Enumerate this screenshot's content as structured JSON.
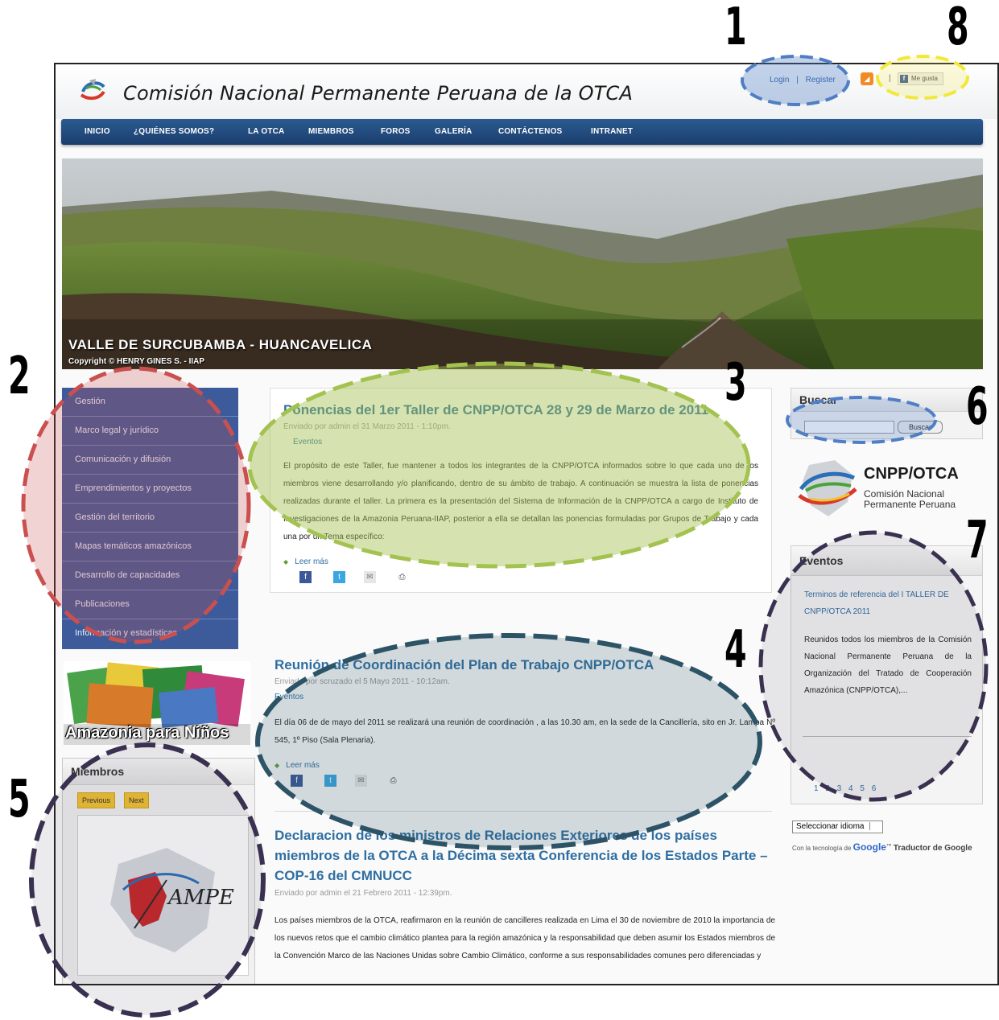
{
  "header": {
    "site_title": "Comisión Nacional Permanente Peruana de la OTCA",
    "login_label": "Login",
    "separator": "|",
    "register_label": "Register",
    "fb_like_label": "Me gusta"
  },
  "nav": {
    "items": [
      "INICIO",
      "¿QUIÉNES SOMOS?",
      "LA OTCA",
      "MIEMBROS",
      "FOROS",
      "GALERÍA",
      "CONTÁCTENOS",
      "INTRANET"
    ]
  },
  "banner": {
    "caption": "VALLE DE SURCUBAMBA - HUANCAVELICA",
    "copyright": "Copyright © HENRY GINES S. - IIAP"
  },
  "left_menu": {
    "items": [
      "Gestión",
      "Marco legal y jurídico",
      "Comunicación y difusión",
      "Emprendimientos y proyectos",
      "Gestión del territorio",
      "Mapas temáticos amazónicos",
      "Desarrollo de capacidades",
      "Publicaciones",
      "Información y estadísticas"
    ]
  },
  "kids_banner": {
    "text": "Amazonia para Niños"
  },
  "miembros": {
    "title": "Miembros",
    "previous_label": "Previous",
    "next_label": "Next",
    "logo_text": "AMPE"
  },
  "articles": [
    {
      "title": "Ponencias del 1er Taller de CNPP/OTCA 28 y 29 de Marzo de 2011",
      "meta": "Enviado por admin el 31 Marzo 2011 - 1:10pm.",
      "tag": "Eventos",
      "body": "El propósito de este Taller, fue mantener a todos los integrantes de la CNPP/OTCA informados sobre lo que cada uno de los miembros viene desarrollando y/o planificando, dentro de su ámbito de trabajo. A continuación se muestra la lista de ponencias realizadas durante el taller. La primera es la presentación del Sistema de Información de la CNPP/OTCA a cargo de Instituto de Investigaciones de la Amazonia Peruana-IIAP, posterior a ella se detallan las ponencias formuladas por Grupos de Trabajo y cada una por un Tema específico:",
      "read_more": "Leer más"
    },
    {
      "title": "Reunión de Coordinación del Plan de Trabajo CNPP/OTCA",
      "meta": "Enviado por scruzado el 5 Mayo 2011 - 10:12am.",
      "tag": "Eventos",
      "body": "El día 06 de de mayo del 2011 se realizará una reunión de coordinación , a las 10.30 am, en la sede de la Cancillería, sito en Jr. Lampa Nº 545, 1º Piso (Sala Plenaria).",
      "read_more": "Leer más"
    },
    {
      "title": "Declaracion de los ministros de Relaciones Exteriores de los países miembros de la OTCA a la Décima sexta Conferencia de los Estados Parte – COP-16 del CMNUCC",
      "meta": "Enviado por admin el 21 Febrero 2011 - 12:39pm.",
      "body": "Los países miembros de la OTCA, reafirmaron en la reunión de cancilleres realizada en Lima el 30 de noviembre de 2010 la importancia de los nuevos retos que el cambio climático plantea para la región amazónica y la responsabilidad que deben asumir los Estados miembros de la Convención Marco de las Naciones Unidas sobre Cambio Climático, conforme a sus responsabilidades comunes pero diferenciadas y"
    }
  ],
  "search": {
    "title": "Buscar",
    "button_label": "Buscar",
    "value": ""
  },
  "cnpp_logo": {
    "name": "CNPP/OTCA",
    "subtitle_line1": "Comisión Nacional",
    "subtitle_line2": "Permanente Peruana"
  },
  "eventos": {
    "title": "Eventos",
    "link": "Terminos de referencia del I TALLER DE CNPP/OTCA 2011",
    "text": "Reunidos todos los miembros de la Comisión Nacional Permanente Peruana de la Organización del Tratado de Cooperación Amazónica (CNPP/OTCA),...",
    "pages": "1 2 3 4 5 6"
  },
  "translate": {
    "select_label": "Seleccionar idioma",
    "powered_prefix": "Con la tecnología de",
    "google": "Google",
    "tm": "™",
    "product": "Traductor de Google"
  },
  "callouts": [
    "1",
    "2",
    "3",
    "4",
    "5",
    "6",
    "7",
    "8"
  ],
  "colors": {
    "nav_blue": "#1f4a7c",
    "menu_blue": "#3d5b9a",
    "link_blue": "#2f6ea2",
    "callout_red": "#c9504f",
    "callout_green": "#a3c24f",
    "callout_blue": "#4f7ec4",
    "callout_yellow": "#f2e83a",
    "callout_dark": "#3a3150",
    "callout_teal": "#2c5366"
  }
}
